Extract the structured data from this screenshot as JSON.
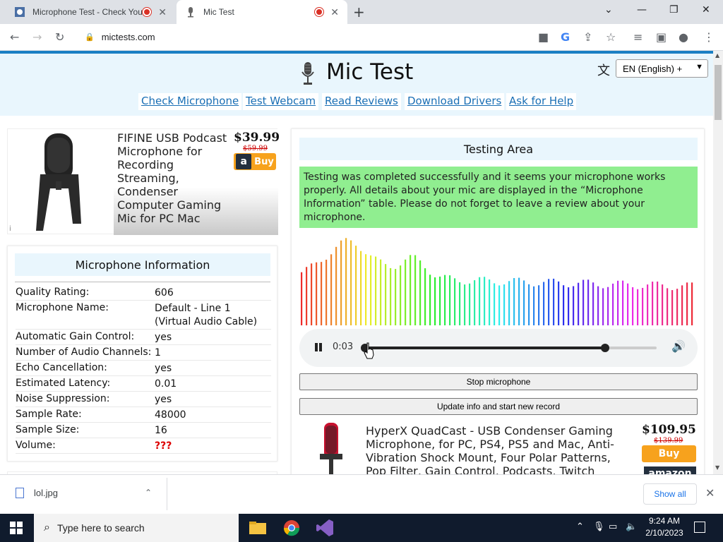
{
  "browser": {
    "tabs": [
      {
        "title": "Microphone Test - Check You",
        "close": "✕"
      },
      {
        "title": "Mic Test",
        "close": "✕"
      }
    ],
    "new_tab": "+",
    "window_controls": {
      "dropdown": "⌄",
      "minimize": "—",
      "restore": "❐",
      "close": "✕"
    },
    "url": "mictests.com"
  },
  "page": {
    "title": "Mic Test",
    "language": "EN (English) +",
    "nav": [
      "Check Microphone",
      "Test Webcam",
      "Read Reviews",
      "Download Drivers",
      "Ask for Help"
    ],
    "ad1": {
      "description": "FIFINE USB Podcast Microphone for Recording Streaming, Condenser Computer Gaming Mic for PC Mac",
      "price": "$39.99",
      "old_price": "$59.99",
      "buy": "Buy",
      "amazon_mark": "a",
      "info_icon": "i"
    },
    "mic_info": {
      "heading": "Microphone Information",
      "rows": [
        {
          "key": "Quality Rating:",
          "value": "606"
        },
        {
          "key": "Microphone Name:",
          "value": "Default - Line 1 (Virtual Audio Cable)"
        },
        {
          "key": "Automatic Gain Control:",
          "value": "yes"
        },
        {
          "key": "Number of Audio Channels:",
          "value": "1"
        },
        {
          "key": "Echo Cancellation:",
          "value": "yes"
        },
        {
          "key": "Estimated Latency:",
          "value": "0.01"
        },
        {
          "key": "Noise Suppression:",
          "value": "yes"
        },
        {
          "key": "Sample Rate:",
          "value": "48000"
        },
        {
          "key": "Sample Size:",
          "value": "16"
        },
        {
          "key": "Volume:",
          "value": "???"
        }
      ]
    },
    "testing": {
      "heading": "Testing Area",
      "message": "Testing was completed successfully and it seems your microphone works properly. All details about your mic are displayed in the “Microphone Information” table. Please do not forget to leave a review about your microphone.",
      "audio_time": "0:03",
      "audio_progress": 0.0,
      "volume_level": 0.8,
      "stop_button": "Stop microphone",
      "update_button": "Update info and start new record"
    },
    "ad2": {
      "description": "HyperX QuadCast - USB Condenser Gaming Microphone, for PC, PS4, PS5 and Mac, Anti-Vibration Shock Mount, Four Polar Patterns, Pop Filter, Gain Control, Podcasts, Twitch",
      "price": "$109.95",
      "old_price": "$139.99",
      "buy": "Buy",
      "amazon": "amazon"
    }
  },
  "downloads": {
    "file": "lol.jpg",
    "show_all": "Show all",
    "close": "✕"
  },
  "taskbar": {
    "search_placeholder": "Type here to search",
    "time": "9:24 AM",
    "date": "2/10/2023"
  },
  "colors": {
    "accent_blue": "#1a7fc4",
    "header_bg": "#e9f6fd",
    "success_bg": "#90ee90",
    "link": "#1a6fb5",
    "buy_orange": "#f7a21d"
  }
}
